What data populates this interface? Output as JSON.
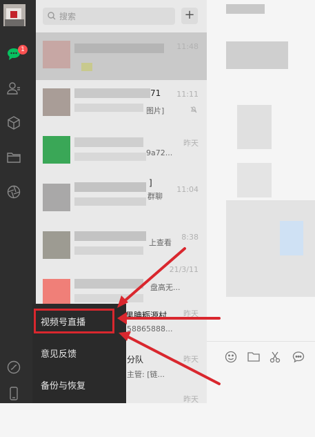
{
  "search": {
    "placeholder": "搜索",
    "add_label": "+"
  },
  "nav": {
    "badge_count": "1"
  },
  "chats": [
    {
      "time": "11:48",
      "fragment": ""
    },
    {
      "time": "11:11",
      "fragment": "71",
      "fragment2": "图片]"
    },
    {
      "time": "昨天",
      "fragment": "",
      "fragment2": "9a72..."
    },
    {
      "time": "11:04",
      "fragment": "]",
      "fragment2": "群聊"
    },
    {
      "time": "8:38",
      "fragment": "",
      "fragment2": "上查看"
    },
    {
      "time": "21/3/11",
      "fragment": "",
      "fragment2": "盘高无..."
    },
    {
      "time": "昨天",
      "fragment": "果腆粝源村",
      "fragment2": "58865888..."
    },
    {
      "time": "昨天",
      "fragment": "分队",
      "fragment2": "主管: [链..."
    },
    {
      "time": "昨天",
      "fragment": "",
      "fragment2": ""
    }
  ],
  "menu": {
    "items": [
      "视频号直播",
      "意见反馈",
      "备份与恢复"
    ]
  },
  "colors": {
    "accent": "#07c160",
    "highlight": "#d9272e",
    "badge": "#fa5151"
  }
}
